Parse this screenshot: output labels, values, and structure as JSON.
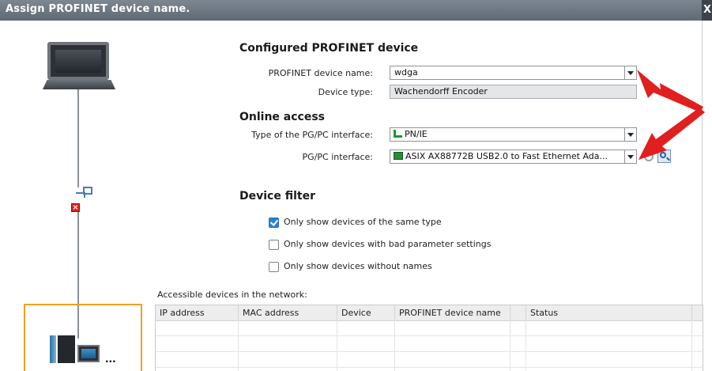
{
  "window": {
    "title": "Assign PROFINET device name.",
    "close_glyph": "X"
  },
  "configured": {
    "heading": "Configured PROFINET device",
    "device_name_label": "PROFINET device name:",
    "device_name_value": "wdga",
    "device_type_label": "Device type:",
    "device_type_value": "Wachendorff Encoder"
  },
  "online": {
    "heading": "Online access",
    "interface_type_label": "Type of the PG/PC interface:",
    "interface_type_value": "PN/IE",
    "interface_label": "PG/PC interface:",
    "interface_value": "ASIX AX88772B USB2.0 to Fast Ethernet Ada..."
  },
  "filter": {
    "heading": "Device filter",
    "options": [
      {
        "label": "Only show devices of the same type",
        "checked": true
      },
      {
        "label": "Only show devices with bad parameter settings",
        "checked": false
      },
      {
        "label": "Only show devices without names",
        "checked": false
      }
    ]
  },
  "grid": {
    "caption": "Accessible devices in the network:",
    "columns": [
      "IP address",
      "MAC address",
      "Device",
      "PROFINET device name",
      "",
      "Status"
    ],
    "rows": 3
  },
  "icons": {
    "laptop": "laptop-icon",
    "network": "network-icon",
    "error": "error-icon",
    "plc": "plc-device-icon",
    "search": "search-icon",
    "refresh": "refresh-icon",
    "nic": "network-adapter-icon",
    "pnie": "pnie-icon"
  },
  "colors": {
    "titlebar": "#6b747d",
    "accent": "#2f7fd0",
    "annotation_arrow": "#e01f1f",
    "highlight_box": "#f0a020"
  }
}
